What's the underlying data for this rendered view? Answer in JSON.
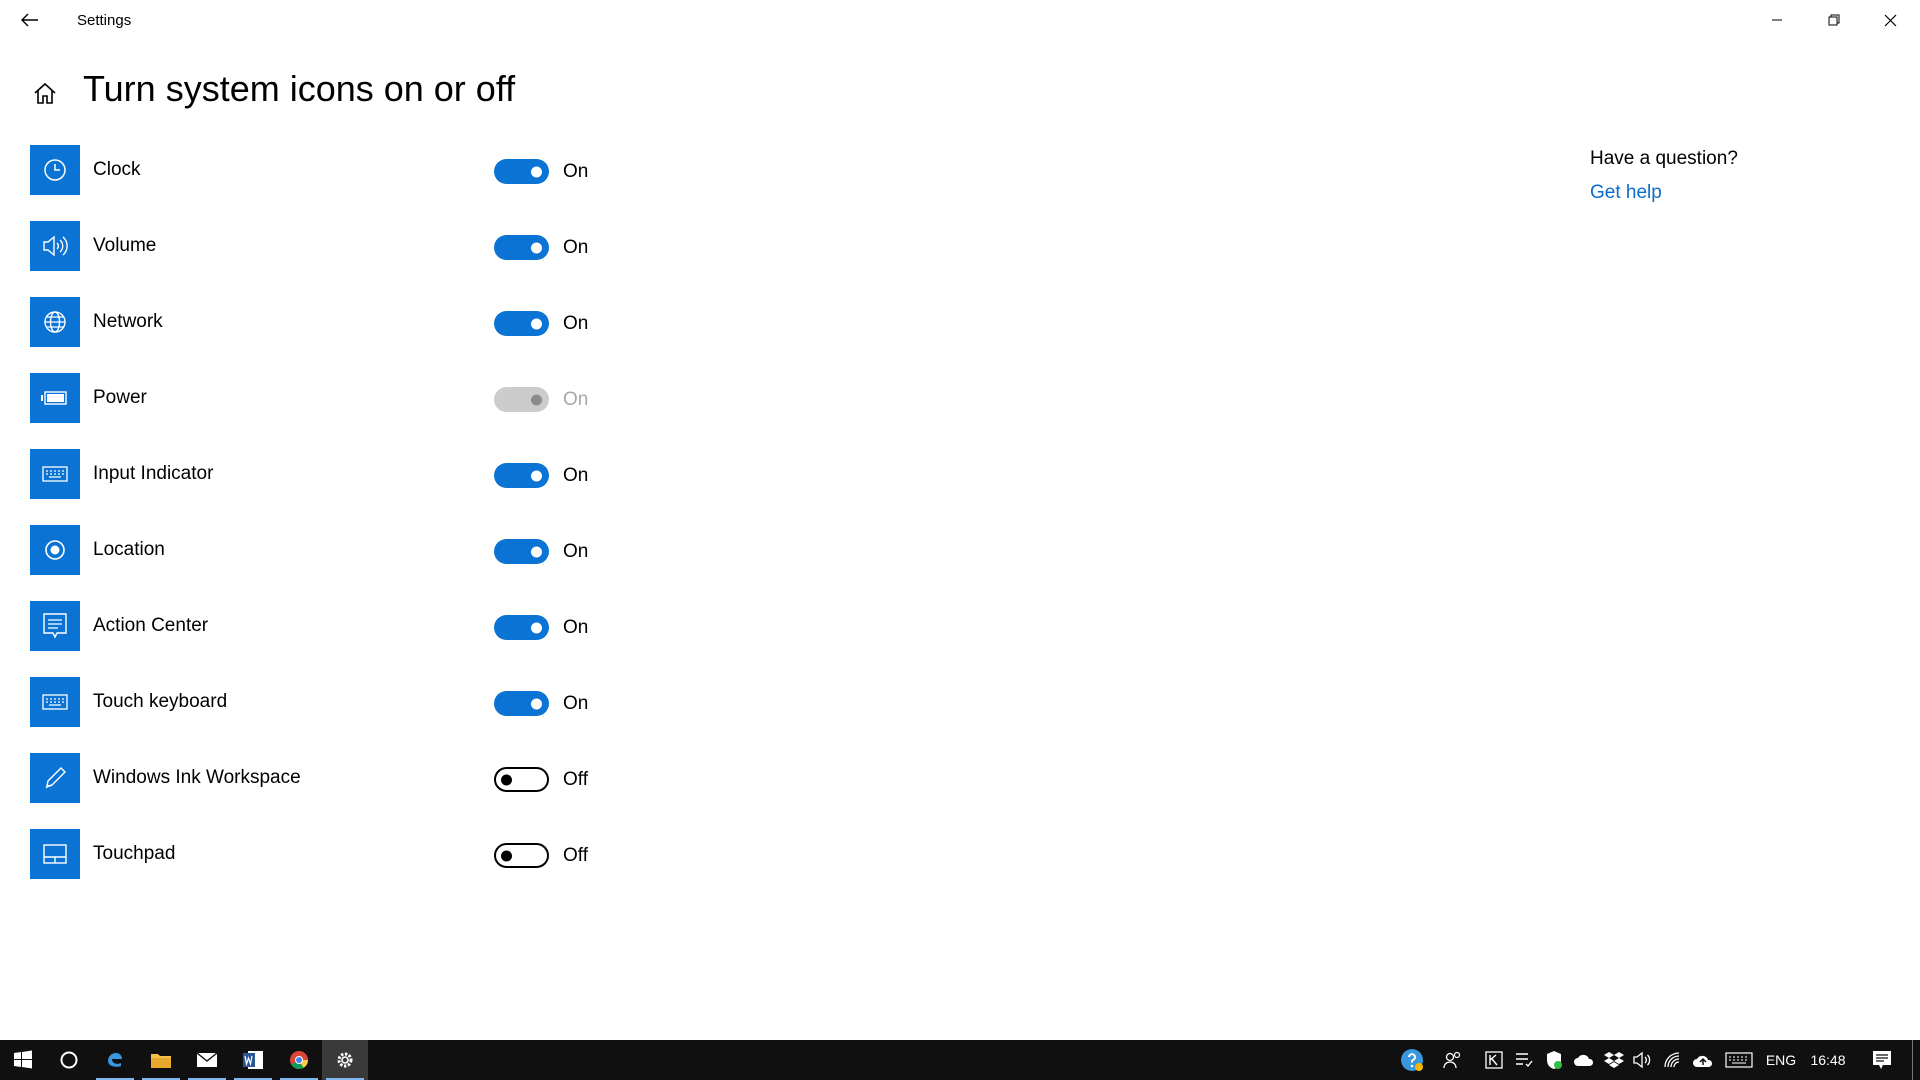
{
  "window": {
    "title": "Settings"
  },
  "page": {
    "title": "Turn system icons on or off"
  },
  "items": [
    {
      "label": "Clock",
      "icon": "clock-icon",
      "state": "On",
      "on": true,
      "disabled": false
    },
    {
      "label": "Volume",
      "icon": "volume-icon",
      "state": "On",
      "on": true,
      "disabled": false
    },
    {
      "label": "Network",
      "icon": "globe-icon",
      "state": "On",
      "on": true,
      "disabled": false
    },
    {
      "label": "Power",
      "icon": "battery-icon",
      "state": "On",
      "on": true,
      "disabled": true
    },
    {
      "label": "Input Indicator",
      "icon": "keyboard-icon",
      "state": "On",
      "on": true,
      "disabled": false
    },
    {
      "label": "Location",
      "icon": "location-icon",
      "state": "On",
      "on": true,
      "disabled": false
    },
    {
      "label": "Action Center",
      "icon": "action-center-icon",
      "state": "On",
      "on": true,
      "disabled": false
    },
    {
      "label": "Touch keyboard",
      "icon": "touch-keyboard-icon",
      "state": "On",
      "on": true,
      "disabled": false
    },
    {
      "label": "Windows Ink Workspace",
      "icon": "pen-icon",
      "state": "Off",
      "on": false,
      "disabled": false
    },
    {
      "label": "Touchpad",
      "icon": "touchpad-icon",
      "state": "Off",
      "on": false,
      "disabled": false
    }
  ],
  "help": {
    "question": "Have a question?",
    "link": "Get help"
  },
  "taskbar": {
    "language": "ENG",
    "time": "16:48"
  },
  "colors": {
    "accent": "#0a73d4",
    "link": "#0a6cc9",
    "taskbar": "#101010"
  }
}
